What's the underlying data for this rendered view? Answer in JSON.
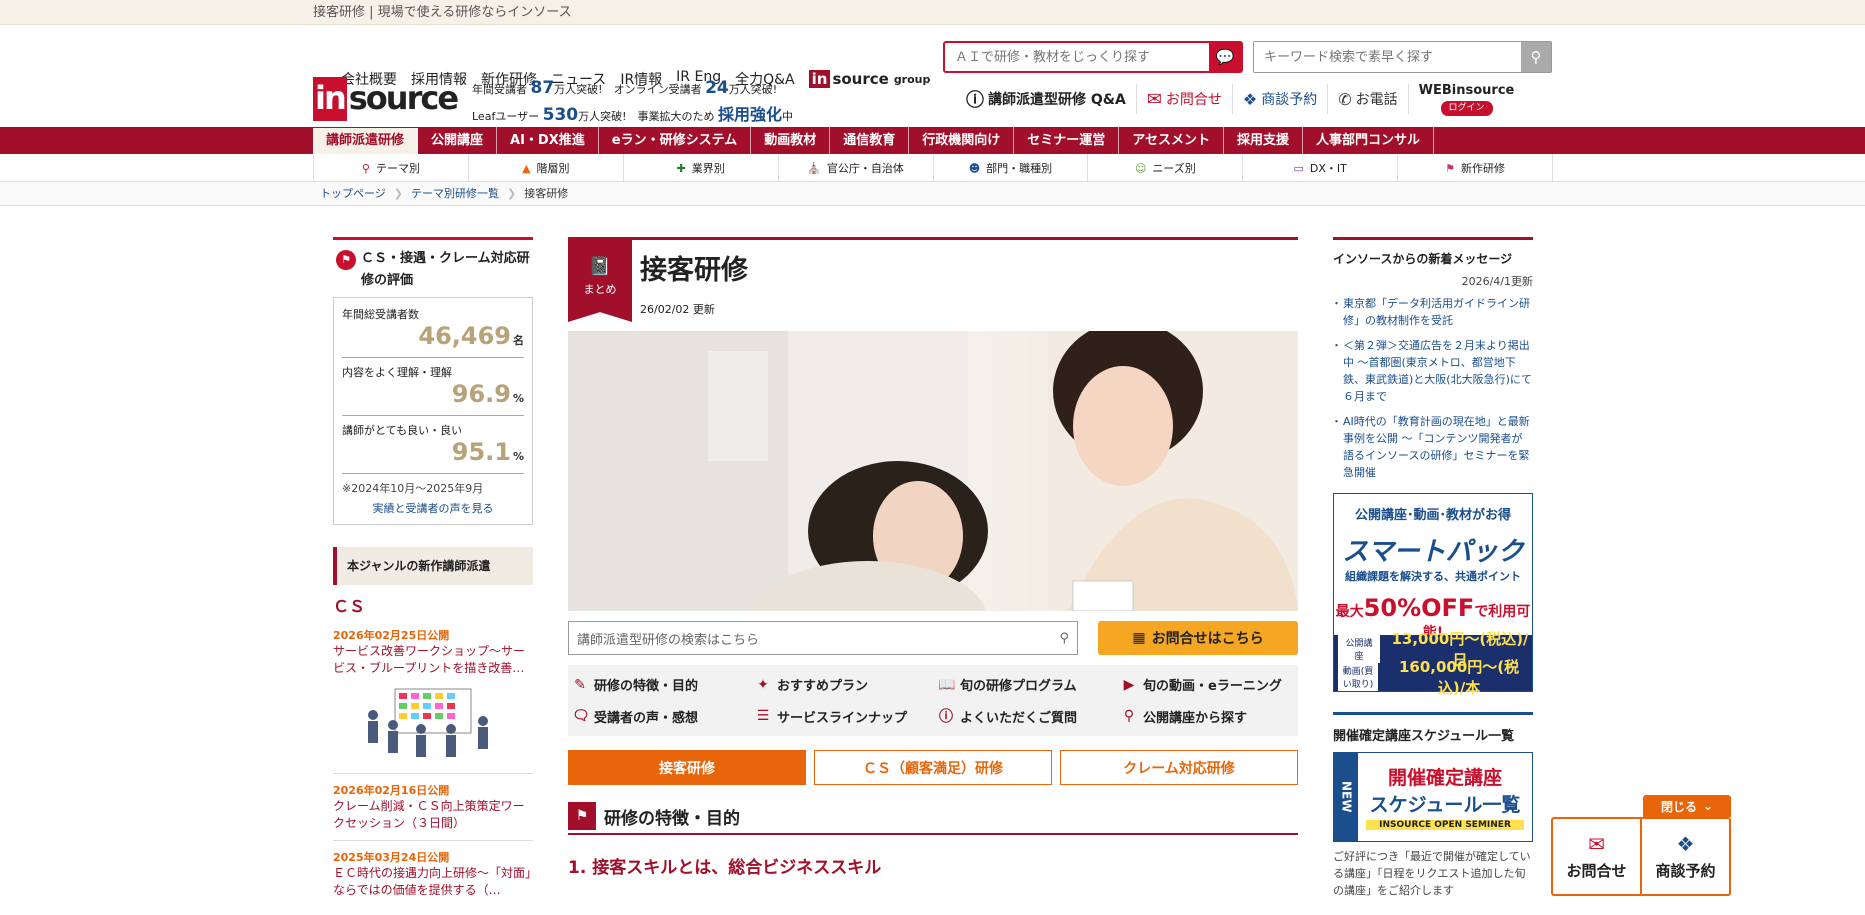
{
  "topstrip": {
    "text": "接客研修 | 現場で使える研修ならインソース"
  },
  "util": {
    "items": [
      "会社概要",
      "採用情報",
      "新作研修",
      "ニュース",
      "IR情報",
      "IR Eng",
      "全力Q&A"
    ],
    "group_in": "in",
    "group_source": "source",
    "group_label": "group"
  },
  "logo": {
    "in": "in",
    "source": "source"
  },
  "stats": {
    "l1a": "年間受講者",
    "l1n": "87",
    "l1b": "万人突破!",
    "l1c": "オンライン受講者",
    "l1n2": "24",
    "l1d": "万人突破!",
    "l2a": "Leafユーザー",
    "l2n": "530",
    "l2b": "万人突破!",
    "l2c": "事業拡大のため",
    "l2h": "採用強化",
    "l2d": "中"
  },
  "search": {
    "ai_placeholder": "ＡＩで研修・教材をじっくり探す",
    "kw_placeholder": "キーワード検索で素早く探す"
  },
  "hlinks": {
    "qa": "講師派遣型研修 Q&A",
    "contact": "お問合せ",
    "meeting": "商談予約",
    "phone": "お電話",
    "web": "WEBinsource",
    "login": "ログイン"
  },
  "mainnav": [
    "講師派遣研修",
    "公開講座",
    "AI・DX推進",
    "eラン・研修システム",
    "動画教材",
    "通信教育",
    "行政機関向け",
    "セミナー運営",
    "アセスメント",
    "採用支援",
    "人事部門コンサル"
  ],
  "subnav": [
    "テーマ別",
    "階層別",
    "業界別",
    "官公庁・自治体",
    "部門・職種別",
    "ニーズ別",
    "DX・IT",
    "新作研修"
  ],
  "breadcrumb": [
    "トップページ",
    "テーマ別研修一覧",
    "接客研修"
  ],
  "left": {
    "eval_title": "ＣＳ・接遇・クレーム対応研修の評価",
    "rows": [
      {
        "label": "年間総受講者数",
        "value": "46,469",
        "unit": "名"
      },
      {
        "label": "内容をよく理解・理解",
        "value": "96.9",
        "unit": "%"
      },
      {
        "label": "講師がとても良い・良い",
        "value": "95.1",
        "unit": "%"
      }
    ],
    "note": "※2024年10月～2025年9月",
    "link": "実績と受講者の声を見る",
    "new_head": "本ジャンルの新作講師派遣",
    "cs": "ＣＳ",
    "items": [
      {
        "date": "2026年02月25日公開",
        "title": "サービス改善ワークショップ～サービス・ブループリントを描き改善…"
      },
      {
        "date": "2026年02月16日公開",
        "title": "クレーム削減・ＣＳ向上策策定ワークセッション（３日間）"
      },
      {
        "date": "2025年03月24日公開",
        "title": "ＥＣ時代の接遇力向上研修～「対面」ならではの価値を提供する（…"
      }
    ]
  },
  "center": {
    "badge": "まとめ",
    "title": "接客研修",
    "updated": "26/02/02 更新",
    "search_placeholder": "講師派遣型研修の検索はこちら",
    "contact_btn": "お問合せはこちら",
    "features": [
      "研修の特徴・目的",
      "おすすめプラン",
      "旬の研修プログラム",
      "旬の動画・eラーニング",
      "受講者の声・感想",
      "サービスラインナップ",
      "よくいただくご質問",
      "公開講座から探す"
    ],
    "tabs": [
      "接客研修",
      "ＣＳ（顧客満足）研修",
      "クレーム対応研修"
    ],
    "section": "研修の特徴・目的",
    "h3": "1. 接客スキルとは、総合ビジネススキル"
  },
  "right": {
    "head": "インソースからの新着メッセージ",
    "date": "2026/4/1更新",
    "news": [
      "東京都「データ利活用ガイドライン研修」の教材制作を受託",
      "＜第２弾＞交通広告を２月末より掲出中 ～首都圏(東京メトロ、都営地下鉄、東武鉄道)と大阪(北大阪急行)にて６月まで",
      "AI時代の「教育計画の現在地」と最新事例を公開 ～「コンテンツ開発者が語るインソースの研修」セミナーを緊急開催"
    ],
    "b1a": "公開講座･動画･教材がお得",
    "b1b": "スマートパック",
    "b1c": "組織課題を解決する、共通ポイント",
    "b1d1": "最大",
    "b1d2": "50%OFF",
    "b1d3": "で利用可能!",
    "b1r1l": "公開講座",
    "b1r1p": "13,000円～(税込)/日",
    "b1r2l": "動画(買い取り)",
    "b1r2p": "160,000円～(税込)/本",
    "head2": "開催確定講座スケジュール一覧",
    "b2new": "NEW",
    "b2x": "開催確定講座",
    "b2y": "スケジュール一覧",
    "b2z": "INSOURCE OPEN SEMINER",
    "note": "ご好評につき「最近で開催が確定している講座」「日程をリクエスト追加した旬の講座」をご紹介します"
  },
  "float": {
    "close": "閉じる",
    "contact": "お問合せ",
    "meeting": "商談予約"
  }
}
